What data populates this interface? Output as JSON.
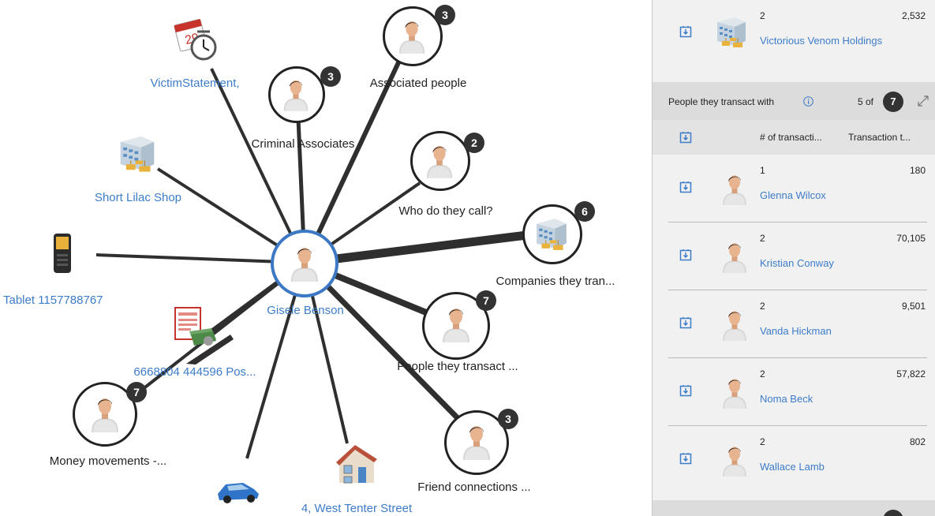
{
  "graph": {
    "center": {
      "label": "Gisele Benson"
    },
    "nodes": [
      {
        "id": "victim-statement",
        "label": "VictimStatement,",
        "icon": "calendar-clock-icon",
        "link": true,
        "badge": null
      },
      {
        "id": "criminal-associates",
        "label": "Criminal Associates",
        "icon": "person-icon",
        "link": false,
        "badge": "3"
      },
      {
        "id": "associated-people",
        "label": "Associated people",
        "icon": "person-icon",
        "link": false,
        "badge": "3"
      },
      {
        "id": "who-do-they-call",
        "label": "Who do they call?",
        "icon": "person-icon",
        "link": false,
        "badge": "2"
      },
      {
        "id": "companies-they-transact",
        "label": "Companies they tran...",
        "icon": "building-icon",
        "link": false,
        "badge": "6"
      },
      {
        "id": "people-they-transact",
        "label": "People they transact ...",
        "icon": "person-icon",
        "link": false,
        "badge": "7"
      },
      {
        "id": "friend-connections",
        "label": "Friend connections ...",
        "icon": "person-icon",
        "link": false,
        "badge": "3"
      },
      {
        "id": "address",
        "label": "4, West Tenter Street",
        "icon": "house-icon",
        "link": true,
        "badge": null
      },
      {
        "id": "vehicle",
        "label": "",
        "icon": "car-icon",
        "link": true,
        "badge": null
      },
      {
        "id": "money-movements",
        "label": "Money movements -...",
        "icon": "person-icon",
        "link": false,
        "badge": "7"
      },
      {
        "id": "payment",
        "label": "6668804 444596 Pos...",
        "icon": "money-document-icon",
        "link": true,
        "badge": null
      },
      {
        "id": "tablet",
        "label": "Tablet 1157788767",
        "icon": "phone-icon",
        "link": true,
        "badge": null
      },
      {
        "id": "short-lilac-shop",
        "label": "Short Lilac Shop",
        "icon": "building-icon",
        "link": true,
        "badge": null
      }
    ]
  },
  "panel": {
    "top_entity": {
      "count": "2",
      "value": "2,532",
      "name": "Victorious Venom Holdings",
      "icon": "building-icon"
    },
    "section": {
      "title": "People they transact with",
      "info_icon": "info-icon",
      "shown": "5 of",
      "total": "7",
      "expand_icon": "expand-icon",
      "columns": [
        "# of transacti...",
        "Transaction t..."
      ],
      "rows": [
        {
          "count": "1",
          "value": "180",
          "name": "Glenna Wilcox"
        },
        {
          "count": "2",
          "value": "70,105",
          "name": "Kristian Conway"
        },
        {
          "count": "2",
          "value": "9,501",
          "name": "Vanda Hickman"
        },
        {
          "count": "2",
          "value": "57,822",
          "name": "Noma Beck"
        },
        {
          "count": "2",
          "value": "802",
          "name": "Wallace Lamb"
        }
      ]
    }
  },
  "colors": {
    "link": "#3d7cc9",
    "badge": "#333333",
    "edge": "#2f2f2f",
    "center_ring": "#3d78c4"
  }
}
